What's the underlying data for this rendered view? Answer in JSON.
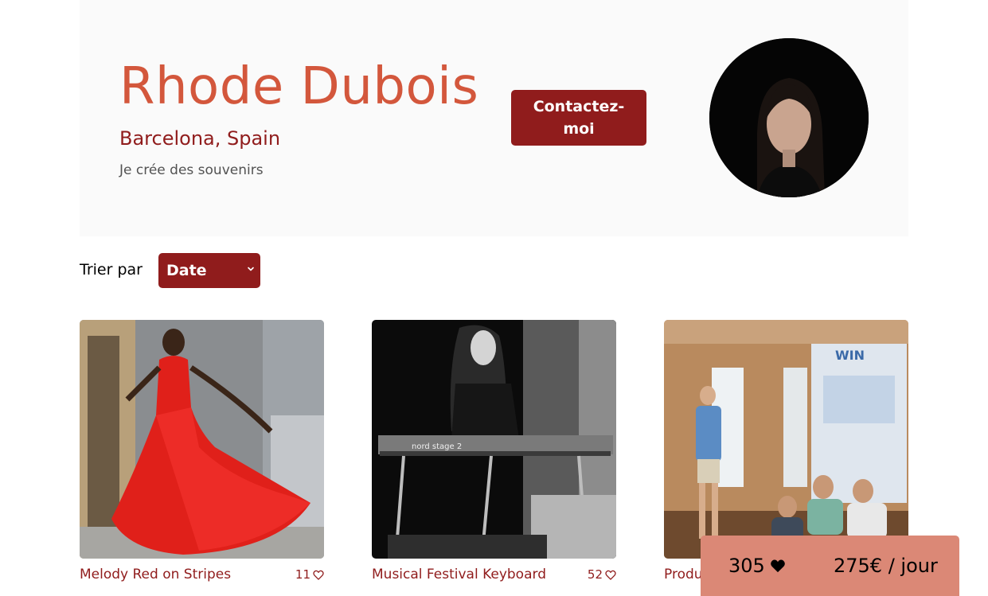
{
  "photographer": {
    "name": "Rhode Dubois",
    "location": "Barcelona, Spain",
    "tagline": "Je crée des souvenirs",
    "contact_label": "Contactez-moi"
  },
  "sort": {
    "label": "Trier par",
    "selected": "Date"
  },
  "media": [
    {
      "title": "Melody Red on Stripes",
      "likes": "11"
    },
    {
      "title": "Musical Festival Keyboard",
      "likes": "52"
    },
    {
      "title": "Product Pitch",
      "likes": ""
    }
  ],
  "stats": {
    "total_likes": "305",
    "rate": "275€ / jour"
  },
  "icons": {
    "like": "heart-outline-icon",
    "total_like": "heart-solid-icon",
    "sort": "chevron-down-icon"
  },
  "colors": {
    "primary": "#901C1C",
    "accent": "#D3573C",
    "stats_background": "#DB8876",
    "header_background": "#FAFAFA"
  }
}
